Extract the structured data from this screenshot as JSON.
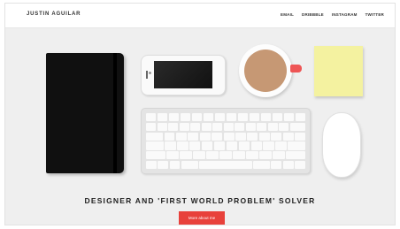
{
  "header": {
    "brand": "JUSTIN AGUILAR",
    "nav": [
      "EMAIL",
      "DRIBBBLE",
      "INSTAGRAM",
      "TWITTER"
    ]
  },
  "hero": {
    "headline": "DESIGNER AND 'FIRST WORLD PROBLEM' SOLVER",
    "cta_label": "More about me"
  },
  "colors": {
    "accent": "#e8413b",
    "background": "#efefef",
    "sticky_note": "#f4f2a0",
    "coffee": "#c69874"
  },
  "illustration_items": [
    "notebook",
    "phone",
    "coffee-mug",
    "sticky-note",
    "keyboard",
    "mouse"
  ]
}
